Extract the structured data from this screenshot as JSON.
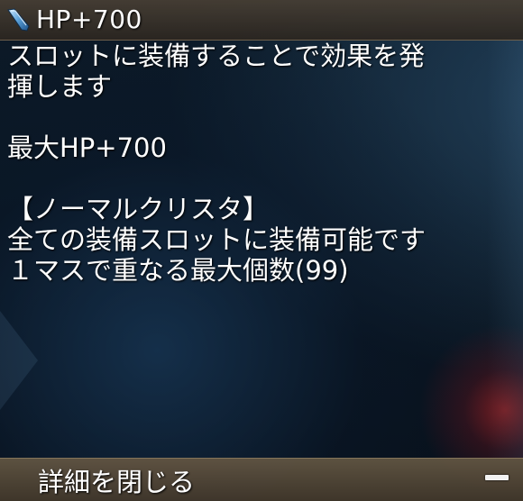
{
  "item": {
    "name": "HP+700",
    "icon": "crystal-icon"
  },
  "description": {
    "line1": "スロットに装備することで効果を発",
    "line2": "揮します",
    "effect": "最大HP+700",
    "category": "【ノーマルクリスタ】",
    "equip_note": "全ての装備スロットに装備可能です",
    "stack_note": "１マスで重なる最大個数(99)"
  },
  "footer": {
    "close_label": "詳細を閉じる",
    "collapse_icon": "minus-icon"
  },
  "colors": {
    "text": "#ffffff",
    "accent_glow": "#d22828"
  }
}
